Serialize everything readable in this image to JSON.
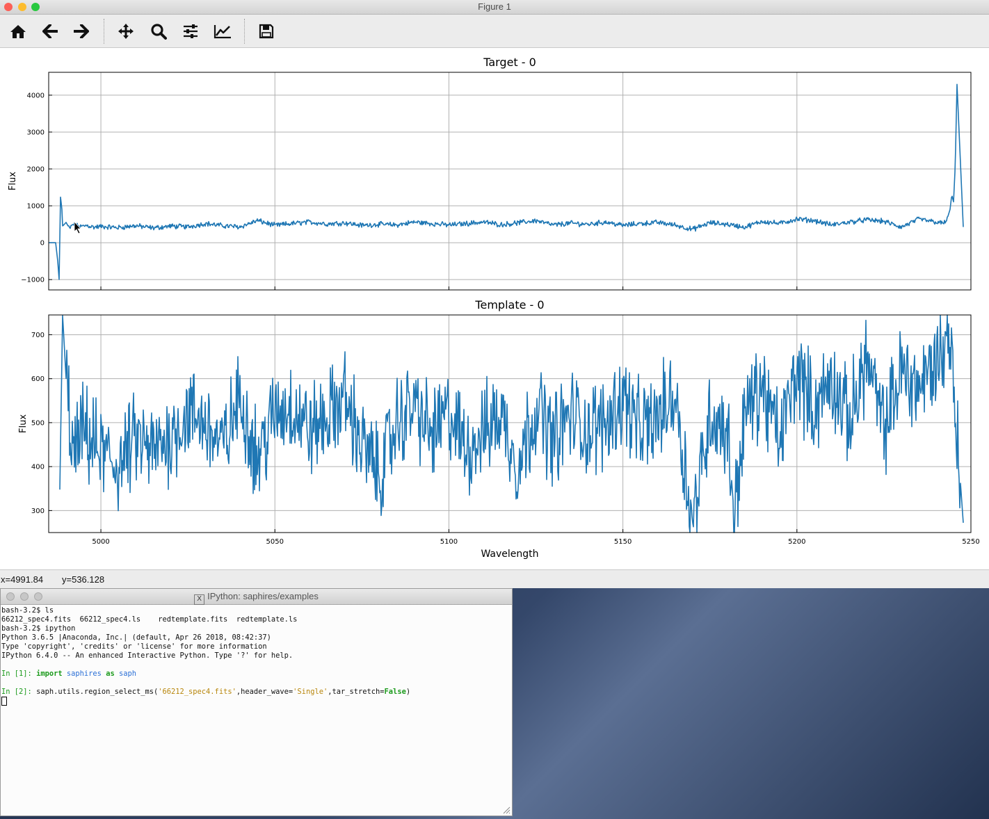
{
  "window": {
    "title": "Figure 1"
  },
  "toolbar": {
    "buttons": [
      {
        "name": "home-icon"
      },
      {
        "name": "back-arrow-icon"
      },
      {
        "name": "forward-arrow-icon"
      },
      {
        "name": "pan-move-icon"
      },
      {
        "name": "zoom-magnifier-icon"
      },
      {
        "name": "configure-subplots-icon"
      },
      {
        "name": "edit-axis-icon"
      },
      {
        "name": "save-floppy-icon"
      }
    ]
  },
  "status": {
    "x": "x=4991.84",
    "y": "y=536.128"
  },
  "colors": {
    "line": "#1f77b4",
    "grid": "#b0b0b0"
  },
  "chart_data": [
    {
      "type": "line",
      "title": "Target - 0",
      "xlabel": "",
      "ylabel": "Flux",
      "xlim": [
        4985,
        5250
      ],
      "ylim": [
        -1280,
        4620
      ],
      "xticks": [
        5000,
        5050,
        5100,
        5150,
        5200,
        5250
      ],
      "yticks": [
        -1000,
        0,
        1000,
        2000,
        3000,
        4000
      ],
      "grid": true,
      "series": [
        {
          "values_description_free": true,
          "x": [
            4985,
            4987,
            4987.6,
            4988,
            4988.4,
            4988.8,
            4989,
            4990,
            4991,
            4992,
            4994,
            4996,
            4998,
            5000,
            5005,
            5010,
            5015,
            5020,
            5025,
            5030,
            5035,
            5040,
            5045,
            5050,
            5055,
            5060,
            5065,
            5070,
            5075,
            5080,
            5085,
            5090,
            5095,
            5100,
            5105,
            5110,
            5115,
            5120,
            5125,
            5130,
            5135,
            5140,
            5145,
            5150,
            5155,
            5160,
            5165,
            5170,
            5175,
            5180,
            5185,
            5190,
            5195,
            5200,
            5205,
            5210,
            5215,
            5220,
            5225,
            5230,
            5235,
            5240,
            5242,
            5243,
            5244,
            5244.5,
            5245,
            5245.5,
            5246,
            5248
          ],
          "y": [
            0,
            0,
            -500,
            -1000,
            1250,
            900,
            450,
            550,
            380,
            500,
            430,
            470,
            420,
            440,
            410,
            460,
            400,
            450,
            430,
            520,
            460,
            430,
            600,
            470,
            520,
            560,
            510,
            540,
            470,
            500,
            480,
            560,
            520,
            480,
            520,
            560,
            490,
            540,
            600,
            480,
            530,
            500,
            560,
            470,
            520,
            550,
            480,
            360,
            540,
            500,
            420,
            580,
            520,
            640,
            600,
            480,
            560,
            620,
            580,
            420,
            640,
            560,
            520,
            600,
            900,
            1300,
            1100,
            2100,
            4300,
            0
          ]
        }
      ]
    },
    {
      "type": "line",
      "title": "Template - 0",
      "xlabel": "Wavelength",
      "ylabel": "Flux",
      "xlim": [
        4985,
        5250
      ],
      "ylim": [
        250,
        745
      ],
      "xticks": [
        5000,
        5050,
        5100,
        5150,
        5200,
        5250
      ],
      "yticks": [
        300,
        400,
        500,
        600,
        700
      ],
      "grid": true,
      "series": [
        {
          "x": [
            4988,
            4989,
            4990,
            4992,
            4995,
            5000,
            5005,
            5010,
            5015,
            5020,
            5025,
            5030,
            5035,
            5040,
            5045,
            5050,
            5055,
            5060,
            5065,
            5070,
            5075,
            5080,
            5085,
            5090,
            5095,
            5100,
            5105,
            5110,
            5115,
            5120,
            5125,
            5130,
            5135,
            5140,
            5145,
            5150,
            5155,
            5160,
            5165,
            5170,
            5175,
            5180,
            5182,
            5185,
            5190,
            5195,
            5200,
            5205,
            5210,
            5215,
            5220,
            5225,
            5230,
            5235,
            5240,
            5244,
            5248
          ],
          "y": [
            250,
            745,
            600,
            420,
            480,
            430,
            400,
            460,
            430,
            470,
            520,
            500,
            440,
            560,
            420,
            520,
            540,
            480,
            510,
            560,
            450,
            380,
            500,
            540,
            470,
            520,
            440,
            480,
            520,
            400,
            540,
            460,
            520,
            480,
            500,
            560,
            480,
            510,
            570,
            270,
            520,
            480,
            290,
            520,
            580,
            460,
            620,
            530,
            600,
            500,
            650,
            480,
            620,
            580,
            640,
            700,
            250
          ]
        }
      ]
    }
  ],
  "terminal": {
    "title": "IPython: saphires/examples",
    "lines": [
      "bash-3.2$ ls",
      "66212_spec4.fits  66212_spec4.ls    redtemplate.fits  redtemplate.ls",
      "bash-3.2$ ipython",
      "Python 3.6.5 |Anaconda, Inc.| (default, Apr 26 2018, 08:42:37)",
      "Type 'copyright', 'credits' or 'license' for more information",
      "IPython 6.4.0 -- An enhanced Interactive Python. Type '?' for help."
    ],
    "in1_prompt": "In [1]:",
    "in1_import": "import",
    "in1_module": "saphires",
    "in1_as": "as",
    "in1_alias": "saph",
    "in2_prompt": "In [2]:",
    "in2_code_a": "saph.utils.region_select_ms(",
    "in2_str1": "'66212_spec4.fits'",
    "in2_code_b": ",header_wave=",
    "in2_str2": "'Single'",
    "in2_code_c": ",tar_stretch=",
    "in2_false": "False",
    "in2_code_d": ")"
  }
}
